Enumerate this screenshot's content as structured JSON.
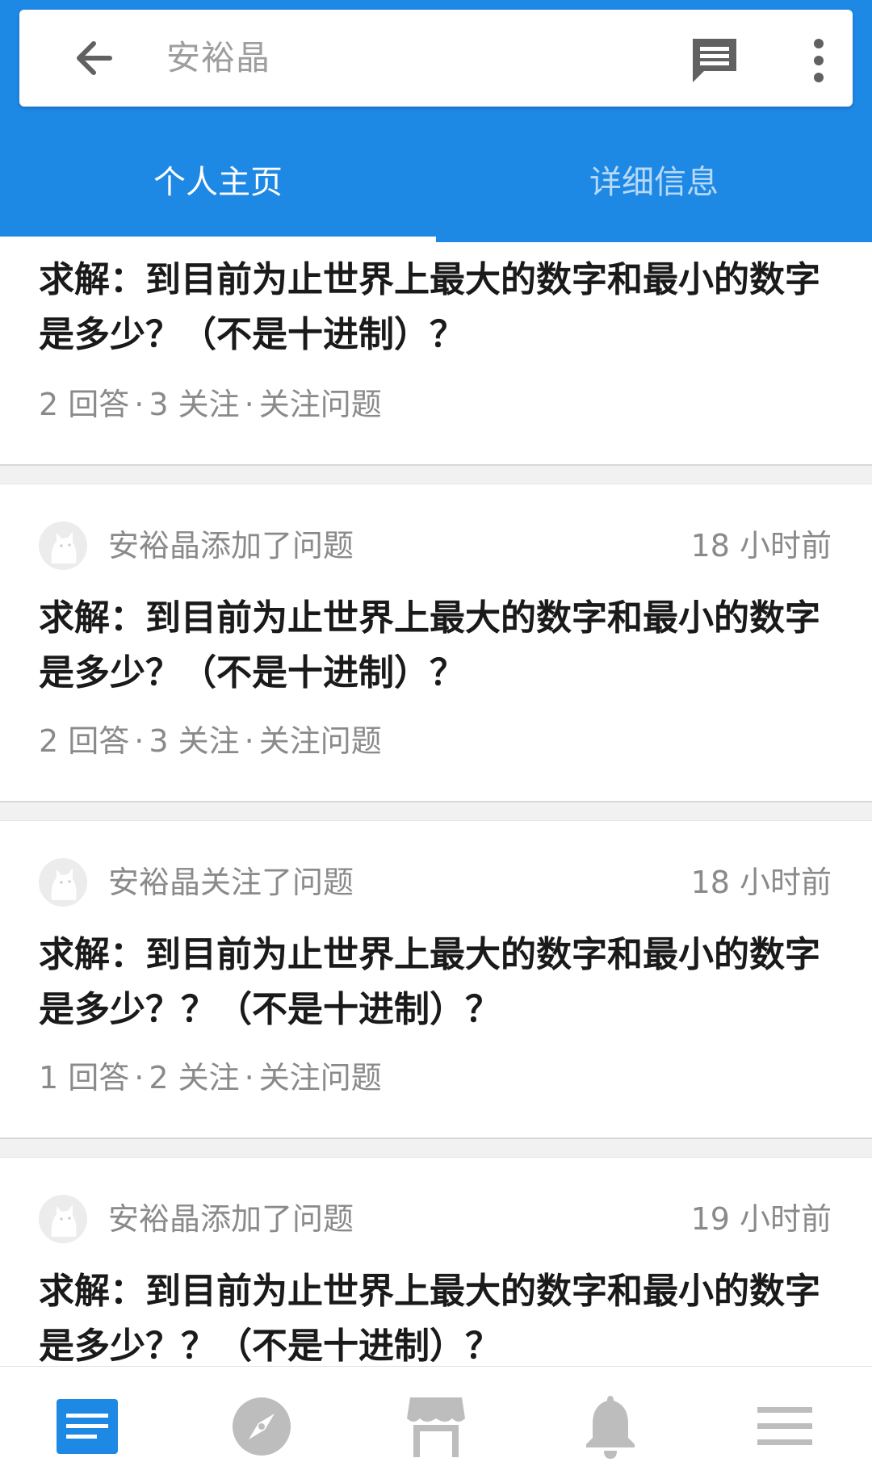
{
  "header": {
    "title": "安裕晶",
    "icons": {
      "back": "back-arrow-icon",
      "messages": "message-icon",
      "more": "more-vert-icon"
    }
  },
  "tabs": [
    {
      "label": "个人主页",
      "active": true
    },
    {
      "label": "详细信息",
      "active": false
    }
  ],
  "colors": {
    "primary": "#1e88e5",
    "nav_active": "#1e88e5",
    "nav_inactive": "#bdbdbd",
    "text_dark": "#1a1a1a",
    "text_muted": "#8a8a8a"
  },
  "feed": [
    {
      "partial": true,
      "title": "求解：到目前为止世界上最大的数字和最小的数字是多少？（不是十进制）？",
      "answers": "2 回答",
      "follows": "3 关注",
      "follow_action": "关注问题"
    },
    {
      "actor": "安裕晶添加了问题",
      "time": "18 小时前",
      "title": "求解：到目前为止世界上最大的数字和最小的数字是多少？（不是十进制）？",
      "answers": "2 回答",
      "follows": "3 关注",
      "follow_action": "关注问题"
    },
    {
      "actor": "安裕晶关注了问题",
      "time": "18 小时前",
      "title": "求解：到目前为止世界上最大的数字和最小的数字是多少？？（不是十进制）？",
      "answers": "1 回答",
      "follows": "2 关注",
      "follow_action": "关注问题"
    },
    {
      "partial": true,
      "actor": "安裕晶添加了问题",
      "time": "19 小时前",
      "title": "求解：到目前为止世界上最大的数字和最小的数字是多少？？（不是十进制）？"
    }
  ],
  "bottom_nav": [
    {
      "icon": "feed-icon",
      "active": true
    },
    {
      "icon": "explore-compass-icon",
      "active": false
    },
    {
      "icon": "store-icon",
      "active": false
    },
    {
      "icon": "notification-bell-icon",
      "active": false
    },
    {
      "icon": "menu-icon",
      "active": false
    }
  ]
}
